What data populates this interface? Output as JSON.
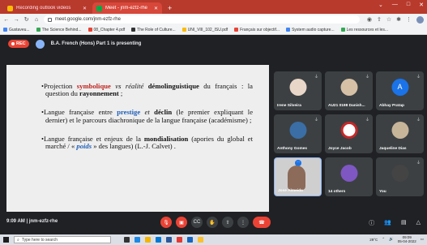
{
  "browser": {
    "tabs": [
      {
        "label": "Recording outlook videos",
        "favicon_color": "#fbbc04"
      },
      {
        "label": "Meet - jnm-ezfz-rhe",
        "favicon_color": "#00ac47"
      }
    ],
    "new_tab_label": "+",
    "url": "meet.google.com/jnm-ezfz-rhe",
    "bookmarks": [
      {
        "label": "Gustaveu...",
        "color": "#4285f4"
      },
      {
        "label": "The Science Behind...",
        "color": "#34a853"
      },
      {
        "label": "08_Chapter 4.pdf",
        "color": "#ea4335"
      },
      {
        "label": "The Role of Culture...",
        "color": "#333333"
      },
      {
        "label": "UNI_VIII_102_ISU.pdf",
        "color": "#fbbc04"
      },
      {
        "label": "Français sur objectif...",
        "color": "#ea4335"
      },
      {
        "label": "System audio capture...",
        "color": "#4285f4"
      },
      {
        "label": "Les ressources et les...",
        "color": "#34a853"
      }
    ]
  },
  "meet": {
    "rec_label": "REC",
    "presenting_text": "B.A. French (Hons) Part 1 is presenting",
    "slide": {
      "bullets": [
        {
          "pre": "Projection ",
          "highlight": "symbolique",
          "mid": " vs réalité ",
          "bold": "démolinguistique",
          "post": " du français : la question du ",
          "bold2": "rayonnement",
          "end": " ;"
        },
        {
          "pre": "Langue française entre ",
          "highlight": "prestige",
          "mid": " et ",
          "bold": "déclin",
          "post": " (le premier expliquant le dernier) et le parcours diachronique de la langue française (académisme) ;"
        },
        {
          "pre": "Langue française et enjeux de la ",
          "bold": "mondialisation",
          "post": " (apories du global et marché / « ",
          "highlight": "poids",
          "end": " » des langues) (L.-J. Calvet) ."
        }
      ]
    },
    "participants": [
      {
        "name": "Irene Silveira",
        "avatar_color": "#e8d6c8"
      },
      {
        "name": "AU21 0198 Danish...",
        "avatar_color": "#d6c1a7"
      },
      {
        "name": "Abhay Pratap",
        "avatar_color": "#1a73e8",
        "initial": "A"
      },
      {
        "name": "Anthony Gomes",
        "avatar_color": "#3a6ea5"
      },
      {
        "name": "Joyce Jacob",
        "avatar_color": "#ffffff"
      },
      {
        "name": "Jaqueline Dias",
        "avatar_color": "#c7b59a"
      },
      {
        "name": "Jose Almeida",
        "avatar_color": "#cfcfcf"
      },
      {
        "name": "14 others",
        "avatar_color": "#7e57c2"
      },
      {
        "name": "You",
        "avatar_color": "#444444"
      }
    ],
    "time": "9:09 AM",
    "separator": "|",
    "meeting_code": "jnm-ezfz-rhe"
  },
  "taskbar": {
    "search_placeholder": "Type here to search",
    "temperature": "29°C",
    "clock_time": "09:09",
    "clock_date": "05-04-2022"
  }
}
